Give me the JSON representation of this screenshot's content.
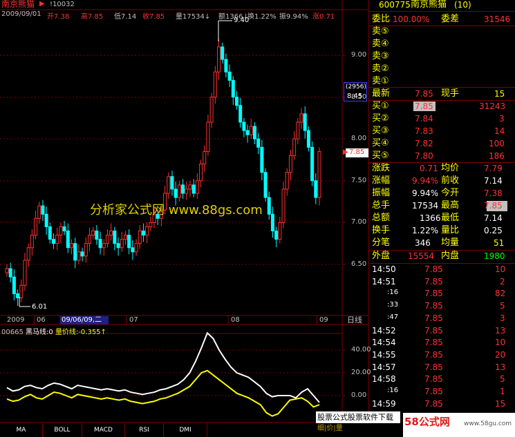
{
  "header": {
    "stock_name": "南京熊猫",
    "code_hint": "!10032",
    "date": "2009/09/01",
    "open_label": "开",
    "open": "7.38",
    "high_label": "高",
    "high": "7.85",
    "low_label": "低",
    "low": "7.14",
    "close_label": "收",
    "close": "7.85",
    "vol_label": "量",
    "vol": "17534",
    "amt_label": "额",
    "amt": "1366",
    "turn_label": "换",
    "turn": "1.22%",
    "amp_label": "振",
    "amp": "9.94%",
    "chg_label": "涨",
    "chg": "0.71"
  },
  "price_axis": [
    "9.00",
    "8.50",
    "8.00",
    "7.50",
    "7.00",
    "6.50"
  ],
  "price_marks": {
    "max_label": "9.40",
    "min_label": "6.01",
    "cursor_price": "8.45",
    "cursor_vol": "(2956)",
    "current_price": "7.85"
  },
  "time_axis": {
    "y2009": "2009",
    "m06": "06",
    "cursor_date": "09/06/09,二",
    "m07": "07",
    "m08": "08",
    "m09": "09",
    "period": "日线"
  },
  "watermark": "分析家公式网 www.88gs.com",
  "indicator": {
    "code": "00665",
    "line1_label": "黑马线:",
    "line1_value": "0",
    "line2_label": "量价线:",
    "line2_value": "-0.355↑",
    "axis": [
      "40.00",
      "20.00",
      "0.00"
    ]
  },
  "tabs": [
    "MA",
    "BOLL",
    "MACD",
    "RSI",
    "DMI"
  ],
  "quote": {
    "code": "600775",
    "name": "南京熊猫",
    "suffix": "(10)",
    "ratio_label": "委比",
    "ratio": "100.00%",
    "diff_label": "委差",
    "diff": "31546",
    "sells": [
      {
        "label": "卖⑤"
      },
      {
        "label": "卖④"
      },
      {
        "label": "卖③"
      },
      {
        "label": "卖②"
      },
      {
        "label": "卖①"
      }
    ],
    "last_label": "最新",
    "last": "7.85",
    "nowvol_label": "现手",
    "nowvol": "15",
    "buys": [
      {
        "label": "买①",
        "price": "7.85",
        "vol": "31243"
      },
      {
        "label": "买②",
        "price": "7.84",
        "vol": "3"
      },
      {
        "label": "买③",
        "price": "7.83",
        "vol": "14"
      },
      {
        "label": "买④",
        "price": "7.82",
        "vol": "100"
      },
      {
        "label": "买⑤",
        "price": "7.80",
        "vol": "186"
      }
    ],
    "stats": [
      {
        "l1": "涨跌",
        "v1": "0.71",
        "l2": "均价",
        "v2": "7.79"
      },
      {
        "l1": "涨幅",
        "v1": "9.94%",
        "l2": "前收",
        "v2": "7.14"
      },
      {
        "l1": "振幅",
        "v1": "9.94%",
        "l2": "今开",
        "v2": "7.38"
      },
      {
        "l1": "总手",
        "v1": "17534",
        "l2": "最高",
        "v2": "7.85"
      },
      {
        "l1": "总额",
        "v1": "1366",
        "l2": "最低",
        "v2": "7.14"
      },
      {
        "l1": "换手",
        "v1": "1.22%",
        "l2": "量比",
        "v2": "0.25"
      },
      {
        "l1": "分笔",
        "v1": "346",
        "l2": "均量",
        "v2": "51"
      }
    ],
    "outer_label": "外盘",
    "outer": "15554",
    "inner_label": "内盘",
    "inner": "1980",
    "ticks": [
      {
        "time": "14:50",
        "price": "7.85",
        "vol": "10"
      },
      {
        "time": "14:51",
        "price": "7.85",
        "vol": "2"
      },
      {
        "time": ":16",
        "price": "7.85",
        "vol": "82"
      },
      {
        "time": ":33",
        "price": "7.85",
        "vol": "5"
      },
      {
        "time": ":47",
        "price": "7.85",
        "vol": "3"
      },
      {
        "time": "14:52",
        "price": "7.85",
        "vol": "13"
      },
      {
        "time": "14:54",
        "price": "7.85",
        "vol": "10"
      },
      {
        "time": "14:55",
        "price": "7.85",
        "vol": "20"
      },
      {
        "time": "14:57",
        "price": "7.85",
        "vol": "13"
      },
      {
        "time": "14:58",
        "price": "7.85",
        "vol": "5"
      },
      {
        "time": ":16",
        "price": "7.85",
        "vol": "1"
      },
      {
        "time": "14:59",
        "price": "7.85",
        "vol": "15"
      }
    ]
  },
  "banner": "股票公式股票软件下载",
  "logo": {
    "brand": "58公式网",
    "url": "www.58gu.com"
  },
  "bottom_fragment": "细|价|量",
  "colors": {
    "up": "#ff3232",
    "down": "#00ffff",
    "frame": "#800000",
    "white_line": "#ffffff",
    "yellow_line": "#ffff00"
  }
}
